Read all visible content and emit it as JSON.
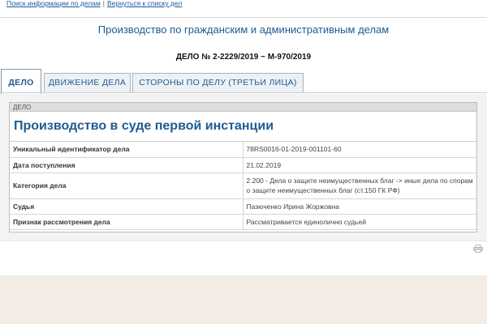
{
  "toplinks": {
    "search_link": "Поиск информации по делам",
    "separator": "|",
    "back_link": "Вернуться к списку дел"
  },
  "header": {
    "court_title": "Производство по гражданским и административным делам",
    "case_number": "ДЕЛО № 2-2229/2019 ~ М-970/2019"
  },
  "tabs": [
    {
      "label": "ДЕЛО",
      "active": true
    },
    {
      "label": "ДВИЖЕНИЕ ДЕЛА",
      "active": false
    },
    {
      "label": "СТОРОНЫ ПО ДЕЛУ (ТРЕТЬИ ЛИЦА)",
      "active": false
    }
  ],
  "case_card": {
    "header": "ДЕЛО",
    "title": "Производство в суде первой инстанции",
    "rows": [
      {
        "label": "Уникальный идентификатор дела",
        "value": "78RS0016-01-2019-001101-60"
      },
      {
        "label": "Дата поступления",
        "value": "21.02.2019"
      },
      {
        "label": "Категория дела",
        "value": "2.200 - Дела о защите неимущественных благ -> иные дела по спорам о защите неимущественных благ (ст.150 ГК РФ)"
      },
      {
        "label": "Судья",
        "value": "Пазюченко Ирина Жоржовна"
      },
      {
        "label": "Признак рассмотрения дела",
        "value": "Рассматривается единолично судьей"
      }
    ]
  },
  "icons": {
    "print": "printer-icon"
  },
  "colors": {
    "link": "#1a5a96",
    "title": "#1e5c93",
    "background": "#f2ece4"
  }
}
